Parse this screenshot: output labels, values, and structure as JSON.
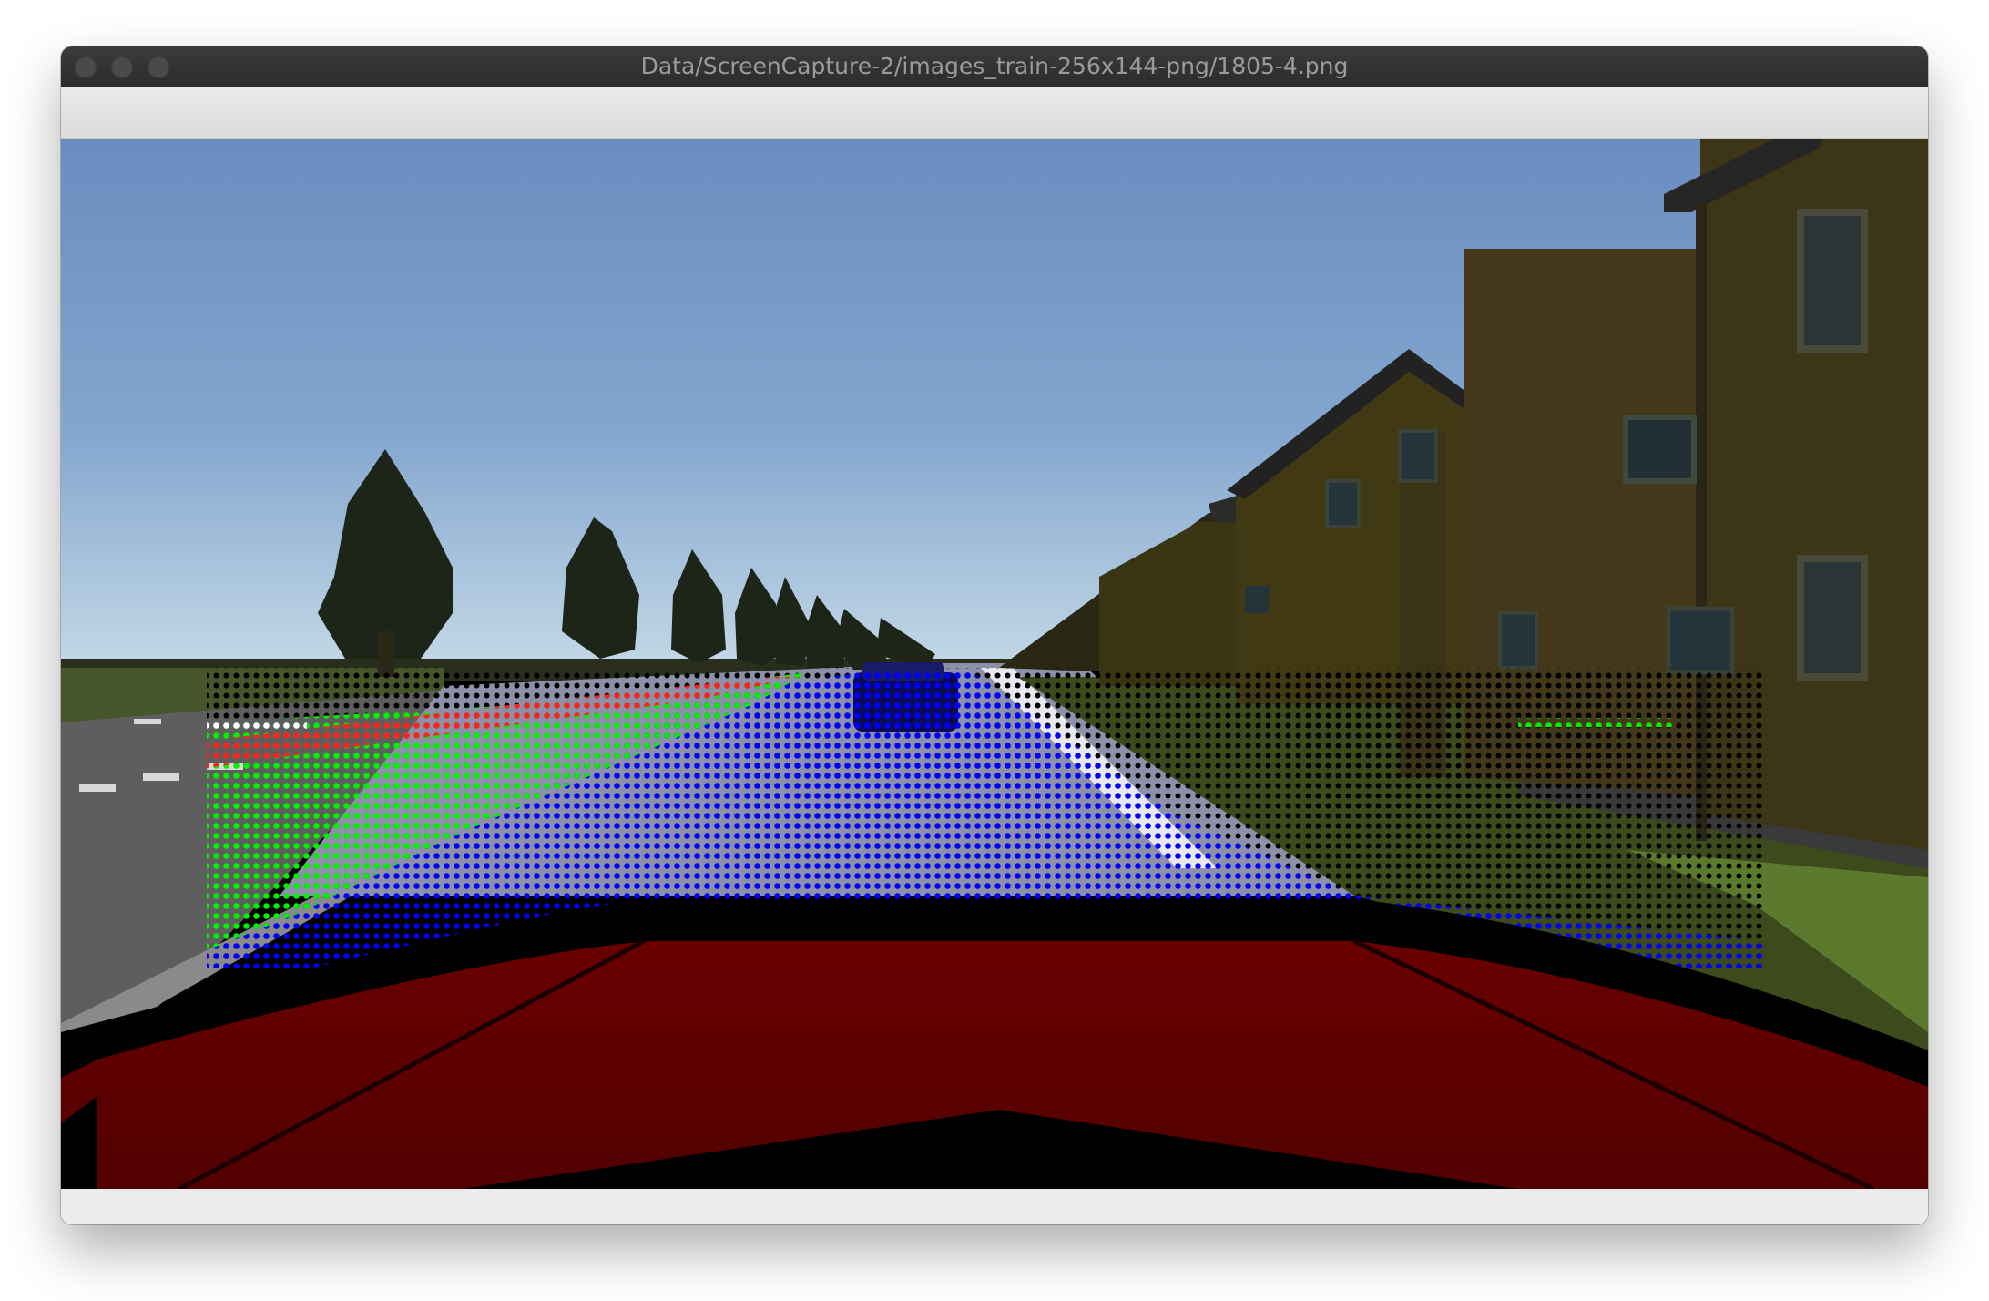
{
  "window": {
    "title": "Data/ScreenCapture-2/images_train-256x144-png/1805-4.png"
  },
  "image": {
    "description_icon": "image-viewer-content",
    "overlay_colors": {
      "road": "#0000ff",
      "grass_left": "#00ff00",
      "lane_edge": "#ff0000",
      "background": "#000000"
    },
    "scene_colors": {
      "sky_top": "#6b8cc0",
      "sky_bottom": "#b4cde0",
      "house": "#3c3612",
      "car_hood": "#5a0000",
      "grass": "#3f4a1e",
      "road": "#5b5b5b"
    }
  }
}
